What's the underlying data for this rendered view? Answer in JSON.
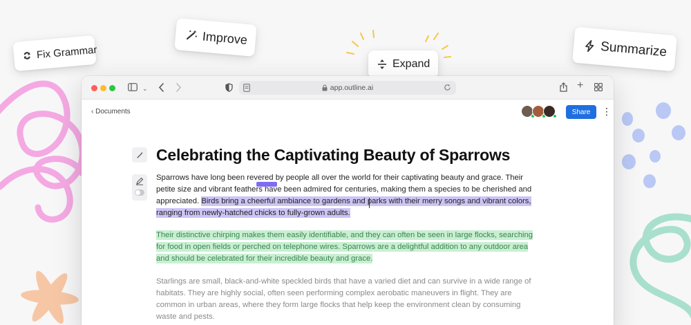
{
  "chips": {
    "fix_grammar": "Fix Grammar",
    "improve": "Improve",
    "expand": "Expand",
    "summarize": "Summarize"
  },
  "browser": {
    "url": "app.outline.ai"
  },
  "doc": {
    "breadcrumb": "‹ Documents",
    "share_label": "Share",
    "title": "Celebrating the Captivating Beauty of Sparrows",
    "para1_plain": "Sparrows have long been revered by people all over the world for their captivating beauty and grace. Their petite size and vibrant feathers have been admired for centuries, making them a species to be cherished and appreciated. ",
    "para1_highlight": "Birds bring a cheerful ambiance to gardens and parks with their merry songs and vibrant colors, ranging from newly-hatched chicks to fully-grown adults.",
    "para2": "Their distinctive chirping makes them easily identifiable, and they can often be seen in large flocks, searching for food in open fields or perched on telephone wires. Sparrows are a delightful addition to any outdoor area and should be celebrated for their incredible beauty and grace.",
    "para3": "Starlings are small, black-and-white speckled birds that have a varied diet and can survive in a wide range of habitats. They are highly social, often seen performing complex aerobatic maneuvers in flight. They are common in urban areas, where they form large flocks that help keep the environment clean by consuming waste and pests."
  },
  "colors": {
    "accent": "#1f6fe0",
    "highlight_purple": "#cbc4f4",
    "highlight_green": "#c9efd2"
  }
}
